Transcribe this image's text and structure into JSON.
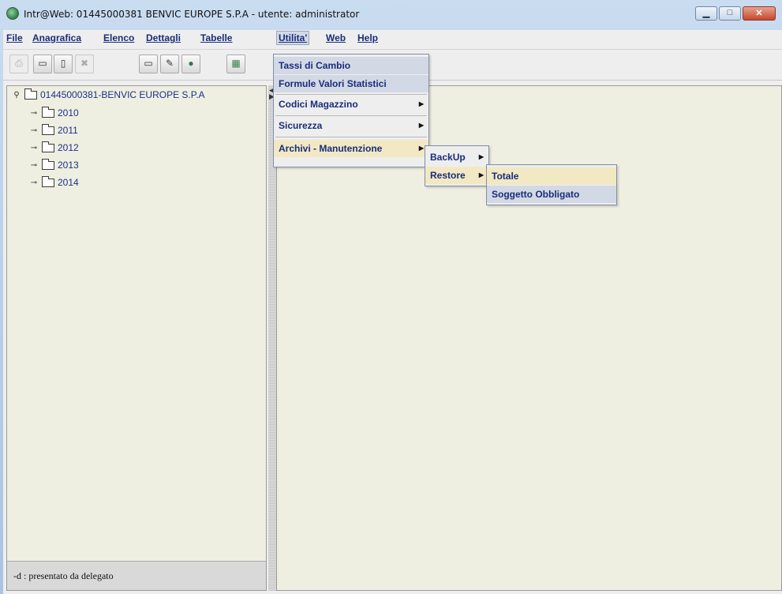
{
  "window": {
    "title": "Intr@Web: 01445000381  BENVIC EUROPE S.P.A - utente: administrator"
  },
  "menubar": {
    "items": [
      {
        "label": "File",
        "mnemonic": "F"
      },
      {
        "label": "Anagrafica",
        "mnemonic": "A"
      },
      {
        "label": "Elenco",
        "mnemonic": "E"
      },
      {
        "label": "Dettagli",
        "mnemonic": "D"
      },
      {
        "label": "Tabelle",
        "mnemonic": "T"
      },
      {
        "label": "Utilita'",
        "mnemonic": "U"
      },
      {
        "label": "Web",
        "mnemonic": "W"
      },
      {
        "label": "Help",
        "mnemonic": "H"
      }
    ]
  },
  "toolbar": {
    "buttons": [
      {
        "icon": "print-icon",
        "enabled": false
      },
      {
        "icon": "open-folder-icon",
        "enabled": true
      },
      {
        "icon": "new-document-icon",
        "enabled": true
      },
      {
        "icon": "delete-icon",
        "enabled": false
      },
      {
        "icon": "card-icon",
        "enabled": true
      },
      {
        "icon": "edit-icon",
        "enabled": true
      },
      {
        "icon": "emblem-icon",
        "enabled": true
      },
      {
        "icon": "calculator-icon",
        "enabled": true
      }
    ]
  },
  "tree": {
    "root": "01445000381-BENVIC EUROPE S.P.A",
    "children": [
      "2010",
      "2011",
      "2012",
      "2013",
      "2014"
    ]
  },
  "status": {
    "text": "-d : presentato da delegato"
  },
  "utilita_menu": {
    "items": [
      {
        "label": "Tassi di Cambio"
      },
      {
        "label": "Formule Valori Statistici"
      },
      {
        "label": "Codici Magazzino"
      },
      {
        "label": "Sicurezza"
      },
      {
        "label": "Archivi - Manutenzione"
      }
    ]
  },
  "archivi_submenu": {
    "items": [
      {
        "label": "BackUp"
      },
      {
        "label": "Restore"
      }
    ]
  },
  "restore_submenu": {
    "items": [
      {
        "label": "Totale"
      },
      {
        "label": "Soggetto Obbligato"
      }
    ]
  }
}
